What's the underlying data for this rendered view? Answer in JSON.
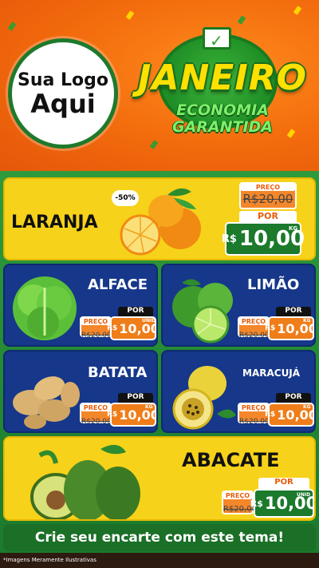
{
  "header": {
    "logo_line1": "Sua Logo",
    "logo_line2": "Aqui",
    "title": "JANEIRO",
    "subtitle_line1": "ECONOMIA",
    "subtitle_line2": "GARANTIDA"
  },
  "products": [
    {
      "name": "LARANJA",
      "discount": "-50%",
      "old_label": "PREÇO",
      "old_price": "R$20,00",
      "por": "POR",
      "currency": "R$",
      "price": "10,00",
      "unit": "KG"
    },
    {
      "name": "ALFACE",
      "old_label": "PREÇO",
      "old_price": "R$20,00",
      "por": "POR",
      "currency": "R$",
      "price": "10,00",
      "unit": "UNID"
    },
    {
      "name": "LIMÃO",
      "old_label": "PREÇO",
      "old_price": "R$20,00",
      "por": "POR",
      "currency": "R$",
      "price": "10,00",
      "unit": "KG"
    },
    {
      "name": "BATATA",
      "old_label": "PREÇO",
      "old_price": "R$20,00",
      "por": "POR",
      "currency": "R$",
      "price": "10,00",
      "unit": "KG"
    },
    {
      "name": "MARACUJÁ",
      "old_label": "PREÇO",
      "old_price": "R$20,00",
      "por": "POR",
      "currency": "R$",
      "price": "10,00",
      "unit": "KG"
    },
    {
      "name": "ABACATE",
      "old_label": "PREÇO",
      "old_price": "R$20,00",
      "por": "POR",
      "currency": "R$",
      "price": "10,00",
      "unit": "UNID"
    }
  ],
  "footer": {
    "cta": "Crie seu encarte com este tema!",
    "note": "*Imagens Meramente Ilustrativas"
  },
  "colors": {
    "orange": "#f26a0c",
    "green": "#1b7a2c",
    "yellow": "#f7d21a",
    "blue": "#16378a",
    "price_orange": "#ef7d1a"
  }
}
